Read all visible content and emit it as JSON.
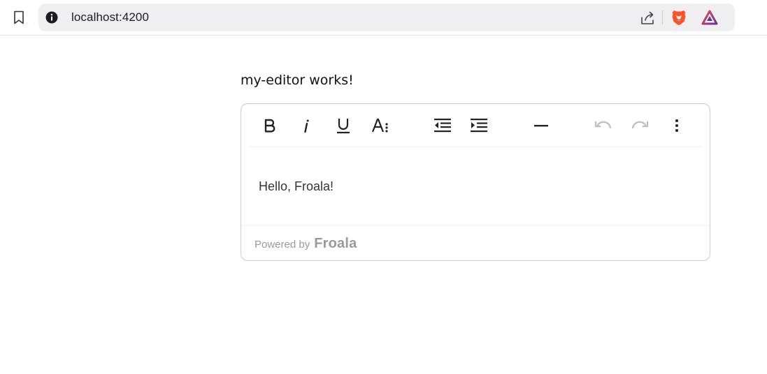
{
  "browser": {
    "url": "localhost:4200",
    "icons": {
      "bookmark": "bookmark-icon",
      "info": "info-icon",
      "share": "share-icon",
      "brave_shields": "brave-lion-icon",
      "rewards": "brave-rewards-triangle-icon"
    },
    "colors": {
      "brave_orange": "#fb542b",
      "rewards_purple": "#6b2fa0",
      "rewards_orange": "#ef4a3f"
    }
  },
  "page": {
    "heading": "my-editor works!"
  },
  "editor": {
    "toolbar": {
      "buttons": [
        {
          "name": "bold",
          "icon": "bold-icon"
        },
        {
          "name": "italic",
          "icon": "italic-icon"
        },
        {
          "name": "underline",
          "icon": "underline-icon"
        },
        {
          "name": "more-text",
          "icon": "text-format-more-icon"
        },
        {
          "name": "outdent",
          "icon": "outdent-icon"
        },
        {
          "name": "indent",
          "icon": "indent-icon"
        },
        {
          "name": "horizontal-line",
          "icon": "horizontal-line-icon"
        },
        {
          "name": "undo",
          "icon": "undo-icon",
          "disabled": true
        },
        {
          "name": "redo",
          "icon": "redo-icon",
          "disabled": true
        },
        {
          "name": "more-misc",
          "icon": "vertical-dots-icon"
        }
      ]
    },
    "content": "Hello, Froala!",
    "footer": {
      "powered_by": "Powered by",
      "brand": "Froala"
    }
  }
}
